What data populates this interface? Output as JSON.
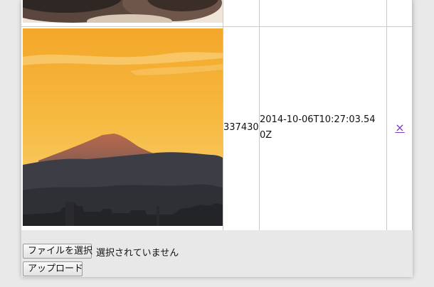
{
  "table": {
    "rows": [
      {
        "image": "portrait-thumbnail",
        "size": "",
        "date": "",
        "delete": ""
      },
      {
        "image": "mount-fuji-sunset-thumbnail",
        "size": "337430",
        "date": "2014-10-06T10:27:03.540Z",
        "delete": "×"
      }
    ]
  },
  "form": {
    "file_button_label": "ファイルを選択",
    "file_status": "選択されていません",
    "upload_button_label": "アップロード"
  },
  "colors": {
    "sky_top": "#f4ae2e",
    "sky_bottom": "#f8c862",
    "mountain": "#3c3d44",
    "link": "#7c3ab8",
    "grid": "#c9c9c9"
  }
}
